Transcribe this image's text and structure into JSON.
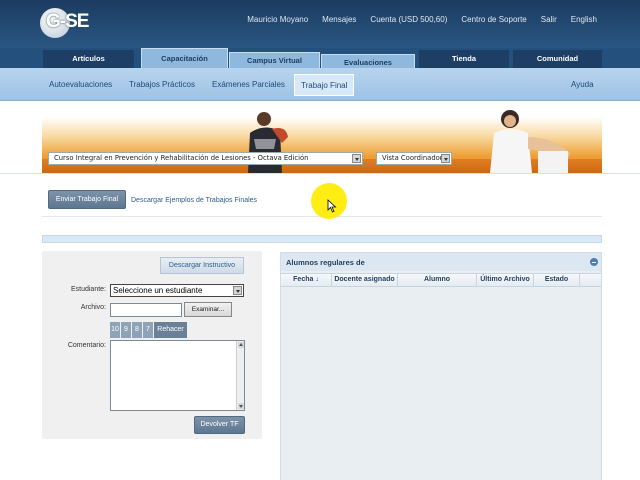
{
  "brand": {
    "logo_text": "G-SE"
  },
  "topnav": {
    "user": "Mauricio Moyano",
    "messages": "Mensajes",
    "account": "Cuenta (USD 500,60)",
    "support": "Centro de Soporte",
    "logout": "Salir",
    "language": "English"
  },
  "tabs": [
    {
      "label": "Artículos",
      "active": false
    },
    {
      "label": "Capacitación",
      "active": true
    },
    {
      "label": "Campus Virtual",
      "active": true
    },
    {
      "label": "Evaluaciones",
      "active": true
    },
    {
      "label": "Tienda",
      "active": false
    },
    {
      "label": "Comunidad",
      "active": false
    }
  ],
  "subnav": {
    "items": [
      {
        "label": "Autoevaluaciones"
      },
      {
        "label": "Trabajos Prácticos"
      },
      {
        "label": "Exámenes Parciales"
      },
      {
        "label": "Trabajo Final",
        "selected": true
      }
    ],
    "help": "Ayuda"
  },
  "banner": {
    "course_select": "Curso Integral en Prevención y Rehabilitación de Lesiones - Octava Edición",
    "view_select": "Vista Coordinador"
  },
  "actions": {
    "submit_final": "Enviar Trabajo Final",
    "download_examples": "Descargar Ejemplos de Trabajos Finales"
  },
  "form": {
    "download_instructive": "Descargar Instructivo",
    "student_label": "Estudiante:",
    "student_value": "Seleccione un estudiante",
    "file_label": "Archivo:",
    "browse": "Examinar...",
    "grades": [
      "10",
      "9",
      "8",
      "7"
    ],
    "redo": "Rehacer",
    "comment_label": "Comentario:",
    "return_button": "Devolver TF"
  },
  "students_panel": {
    "title": "Alumnos regulares de",
    "columns": [
      "Fecha ↓",
      "Docente asignado",
      "Alumno",
      "Último Archivo",
      "Estado"
    ]
  },
  "colors": {
    "header_dark": "#1c3c60",
    "tab_active": "#8fb8de",
    "subnav": "#b7d4ee",
    "cursor_highlight": "#ffeb00",
    "banner_orange": "#ee9f36"
  }
}
